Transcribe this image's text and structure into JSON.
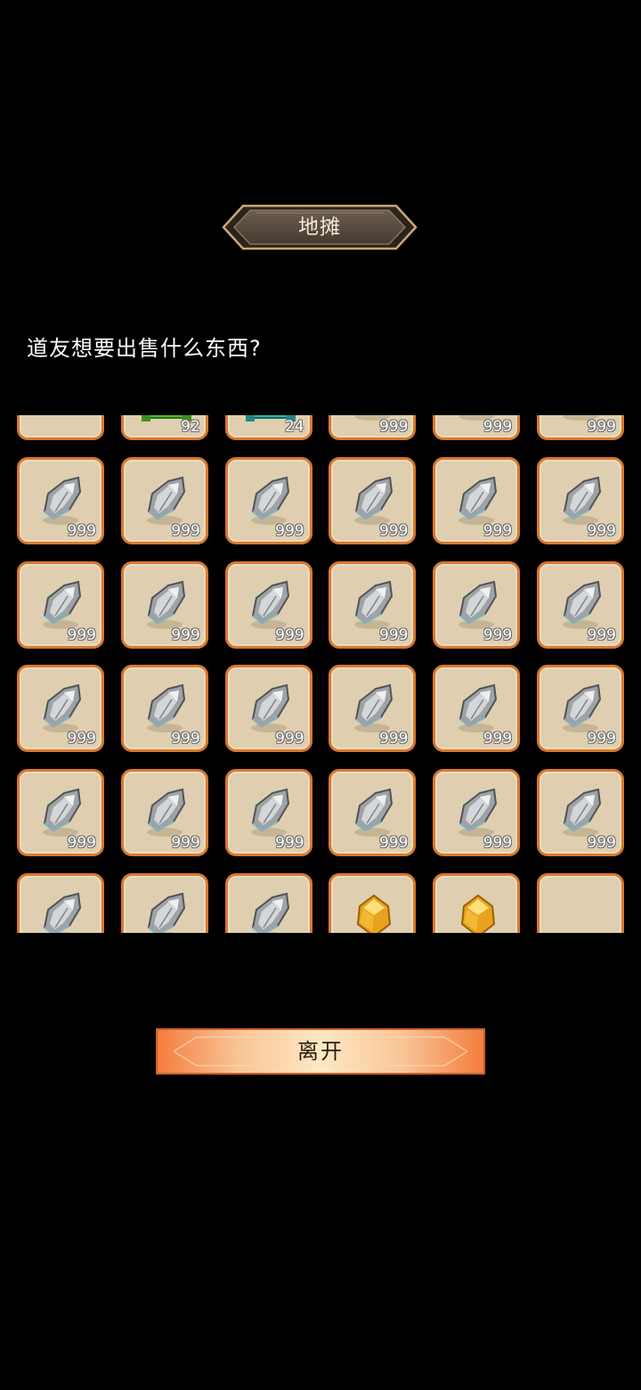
{
  "header": {
    "title": "地摊"
  },
  "prompt": {
    "text": "道友想要出售什么东西?"
  },
  "inventory": {
    "rows": [
      [
        {
          "item": "empty",
          "count": ""
        },
        {
          "item": "green-chest-icon",
          "count": "92"
        },
        {
          "item": "cyan-chest-icon",
          "count": "24"
        },
        {
          "item": "iron-ore-icon",
          "count": "999"
        },
        {
          "item": "iron-ore-icon",
          "count": "999"
        },
        {
          "item": "iron-ore-icon",
          "count": "999"
        }
      ],
      [
        {
          "item": "iron-ore-icon",
          "count": "999"
        },
        {
          "item": "iron-ore-icon",
          "count": "999"
        },
        {
          "item": "iron-ore-icon",
          "count": "999"
        },
        {
          "item": "iron-ore-icon",
          "count": "999"
        },
        {
          "item": "iron-ore-icon",
          "count": "999"
        },
        {
          "item": "iron-ore-icon",
          "count": "999"
        }
      ],
      [
        {
          "item": "iron-ore-icon",
          "count": "999"
        },
        {
          "item": "iron-ore-icon",
          "count": "999"
        },
        {
          "item": "iron-ore-icon",
          "count": "999"
        },
        {
          "item": "iron-ore-icon",
          "count": "999"
        },
        {
          "item": "iron-ore-icon",
          "count": "999"
        },
        {
          "item": "iron-ore-icon",
          "count": "999"
        }
      ],
      [
        {
          "item": "iron-ore-icon",
          "count": "999"
        },
        {
          "item": "iron-ore-icon",
          "count": "999"
        },
        {
          "item": "iron-ore-icon",
          "count": "999"
        },
        {
          "item": "iron-ore-icon",
          "count": "999"
        },
        {
          "item": "iron-ore-icon",
          "count": "999"
        },
        {
          "item": "iron-ore-icon",
          "count": "999"
        }
      ],
      [
        {
          "item": "iron-ore-icon",
          "count": "999"
        },
        {
          "item": "iron-ore-icon",
          "count": "999"
        },
        {
          "item": "iron-ore-icon",
          "count": "999"
        },
        {
          "item": "iron-ore-icon",
          "count": "999"
        },
        {
          "item": "iron-ore-icon",
          "count": "999"
        },
        {
          "item": "iron-ore-icon",
          "count": "999"
        }
      ],
      [
        {
          "item": "iron-ore-icon",
          "count": ""
        },
        {
          "item": "iron-ore-icon",
          "count": ""
        },
        {
          "item": "iron-ore-icon",
          "count": ""
        },
        {
          "item": "gold-crystal-icon",
          "count": ""
        },
        {
          "item": "gold-crystal-icon",
          "count": ""
        },
        {
          "item": "empty",
          "count": ""
        }
      ]
    ]
  },
  "footer": {
    "leave_label": "离开"
  },
  "colors": {
    "background": "#000000",
    "slot_fill": "#dfcfb0",
    "slot_border": "#d9782e",
    "button_orange": "#f08a45",
    "button_cream": "#fbe0b5",
    "title_plate": "#5a4c40",
    "title_trim": "#c9a874"
  }
}
